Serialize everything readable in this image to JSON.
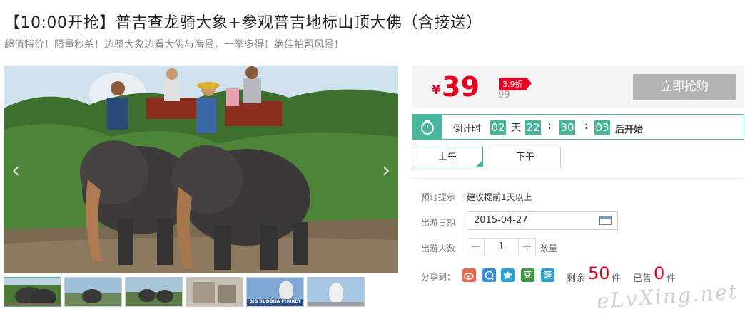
{
  "product": {
    "title": "【10:00开抢】普吉查龙骑大象+参观普吉地标山顶大佛（含接送）",
    "subtitle": "超值特价！限量秒杀！边骑大象边看大佛与海景，一举多得！绝佳拍照风景！"
  },
  "gallery": {
    "thumb_caption": "BIG BUDDHA PHUKET"
  },
  "price": {
    "currency": "¥",
    "current": "39",
    "discount": "3.9折",
    "original": "99",
    "buy_label": "立即抢购"
  },
  "countdown": {
    "label": "倒计时",
    "days": "02",
    "day_unit": "天",
    "hours": "22",
    "minutes": "30",
    "seconds": "03",
    "sep": ":",
    "suffix": "后开始"
  },
  "time_options": [
    "上午",
    "下午"
  ],
  "booking": {
    "tip_label": "预订提示",
    "tip_value": "建议提前1天以上",
    "date_label": "出游日期",
    "date_value": "2015-04-27",
    "people_label": "出游人数",
    "quantity": "1",
    "quantity_unit": "数量",
    "minus": "−",
    "plus": "+"
  },
  "share": {
    "label": "分享到：",
    "icons": [
      "weibo-icon",
      "qzone-icon",
      "favorite-icon",
      "douban-icon",
      "renren-icon"
    ],
    "douban_text": "豆",
    "renren_text": "涯",
    "remaining_label": "剩余",
    "remaining_count": "50",
    "remaining_unit": "件",
    "sold_label": "已售",
    "sold_count": "0",
    "sold_unit": "件"
  },
  "watermark": "eLvXing.net",
  "colors": {
    "accent": "#48b69a",
    "price_red": "#e4001e",
    "button_gray": "#b3b3b3"
  }
}
